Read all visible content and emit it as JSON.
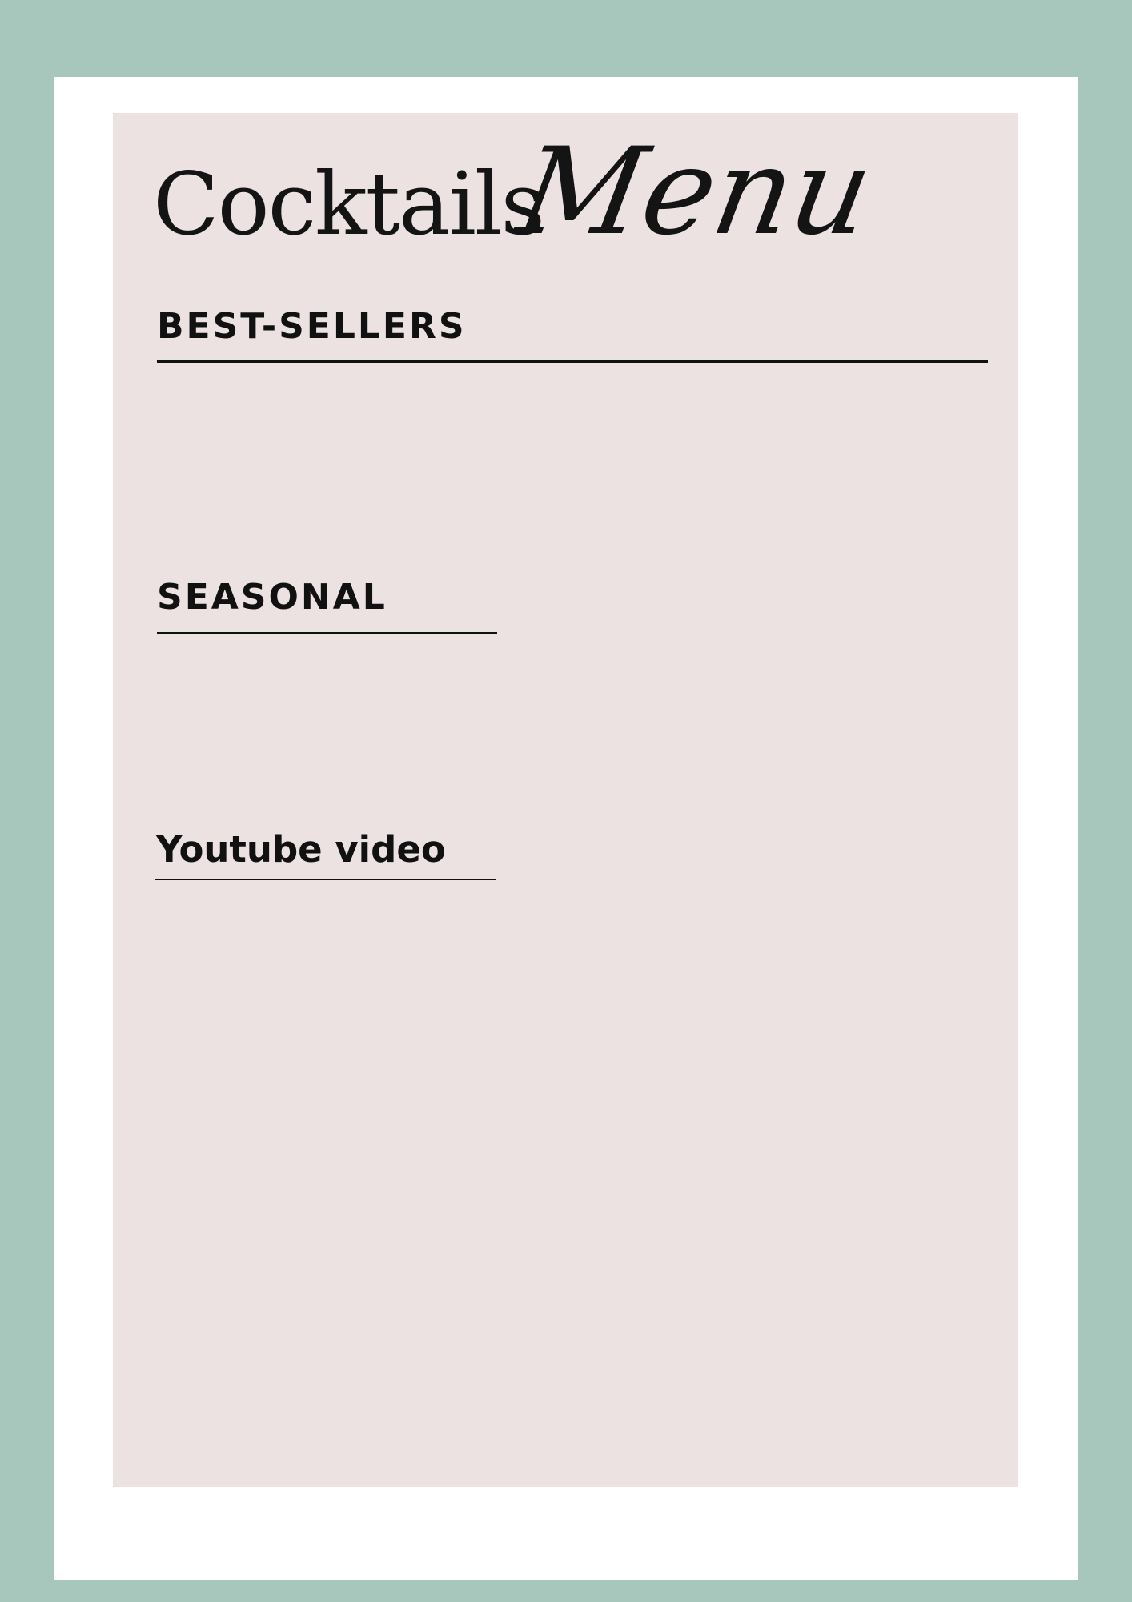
{
  "colors": {
    "page_background": "#a7c7bd",
    "card_background": "#ffffff",
    "panel_background": "#ece2e2",
    "text": "#111111"
  },
  "menu": {
    "title_word_1": "Cocktails",
    "title_word_2": "Menu",
    "sections": [
      {
        "heading": "BEST-SELLERS"
      },
      {
        "heading": "SEASONAL"
      },
      {
        "heading": "Youtube video"
      }
    ]
  }
}
